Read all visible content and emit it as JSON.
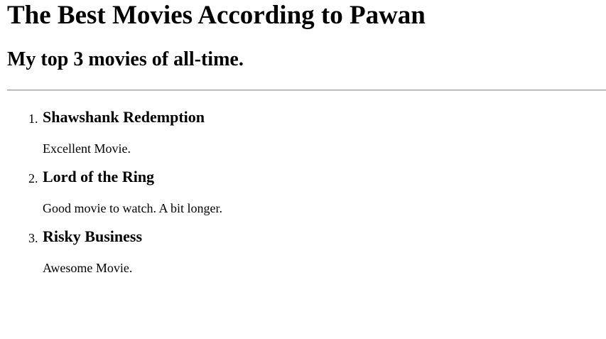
{
  "header": {
    "title": "The Best Movies According to Pawan",
    "subtitle": "My top 3 movies of all-time."
  },
  "movies": [
    {
      "number": "1.",
      "title": "Shawshank Redemption",
      "description": "Excellent Movie."
    },
    {
      "number": "2.",
      "title": "Lord of the Ring",
      "description": "Good movie to watch. A bit longer."
    },
    {
      "number": "3.",
      "title": "Risky Business",
      "description": "Awesome Movie."
    }
  ],
  "colors": {
    "text": "#000000",
    "background": "#ffffff",
    "divider": "#a0a0a0"
  }
}
